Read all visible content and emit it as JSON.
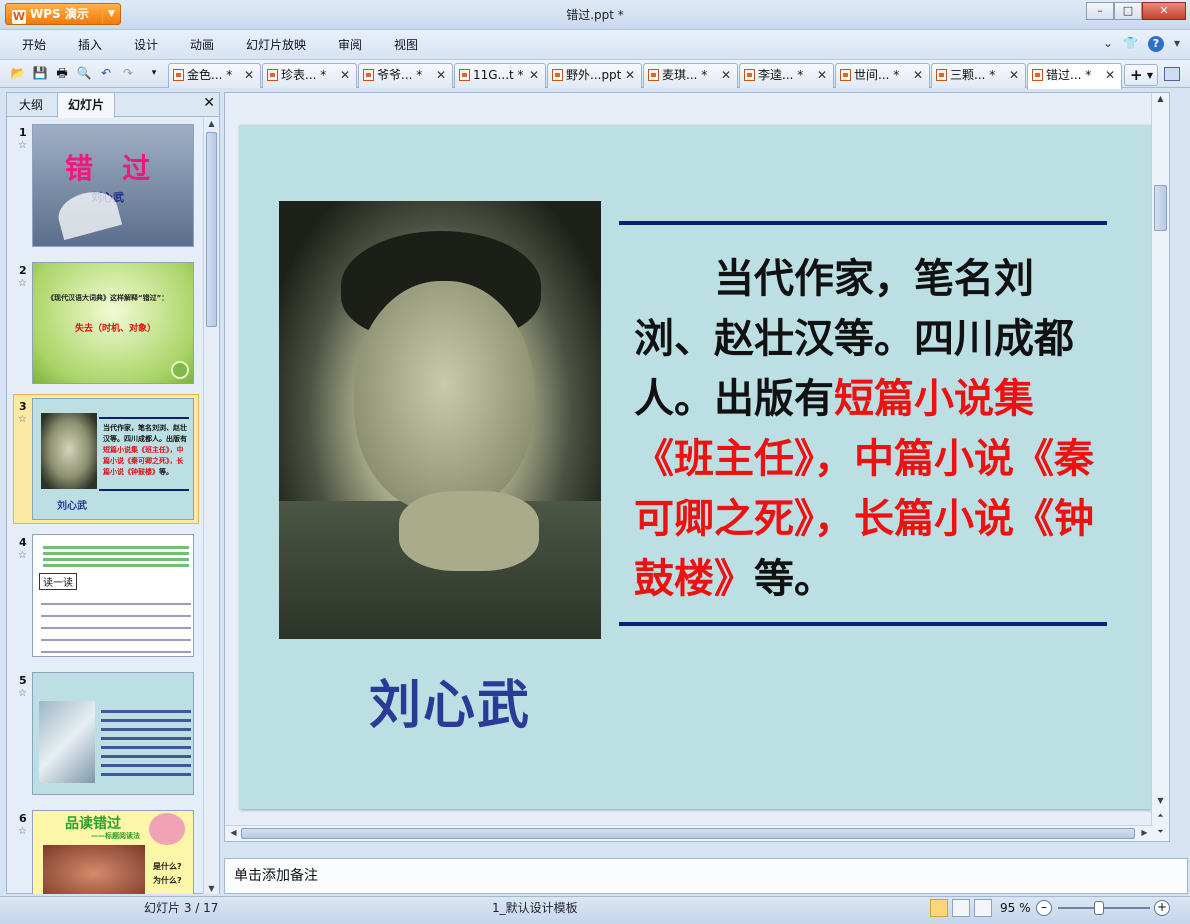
{
  "titlebar": {
    "app_name": "WPS 演示",
    "logo_letter": "W",
    "document_title": "错过.ppt *"
  },
  "menu": [
    "开始",
    "插入",
    "设计",
    "动画",
    "幻灯片放映",
    "审阅",
    "视图"
  ],
  "tabs": [
    {
      "label": "金色... *"
    },
    {
      "label": "珍表... *"
    },
    {
      "label": "爷爷... *"
    },
    {
      "label": "11G...t *"
    },
    {
      "label": "野外...ppt"
    },
    {
      "label": "麦琪... *"
    },
    {
      "label": "李逵... *"
    },
    {
      "label": "世间... *"
    },
    {
      "label": "三颗... *"
    },
    {
      "label": "错过... *"
    }
  ],
  "panel": {
    "tab_outline": "大纲",
    "tab_slides": "幻灯片"
  },
  "thumbnails": [
    {
      "num": "1",
      "title": "错   过",
      "author": "刘心武"
    },
    {
      "num": "2",
      "line1": "《现代汉语大词典》这样解释“错过”：",
      "line2": "失去（时机、对象）"
    },
    {
      "num": "3",
      "author": "刘心武"
    },
    {
      "num": "4",
      "button": "读一读"
    },
    {
      "num": "5"
    },
    {
      "num": "6",
      "title": "品读错过",
      "subtitle": "——标题阅读法",
      "q1": "是什么?",
      "q2": "为什么?"
    }
  ],
  "slide": {
    "bio_plain_1": "当代作家，笔名刘浏、赵壮汉等。四川成都人。出版有",
    "bio_red": "短篇小说集《班主任》，中篇小说《秦可卿之死》，长篇小说《钟鼓楼》",
    "bio_plain_2": "等。",
    "author": "刘心武"
  },
  "notes_placeholder": "单击添加备注",
  "status": {
    "slide_count": "幻灯片 3 / 17",
    "template": "1_默认设计模板",
    "zoom": "95 %"
  }
}
